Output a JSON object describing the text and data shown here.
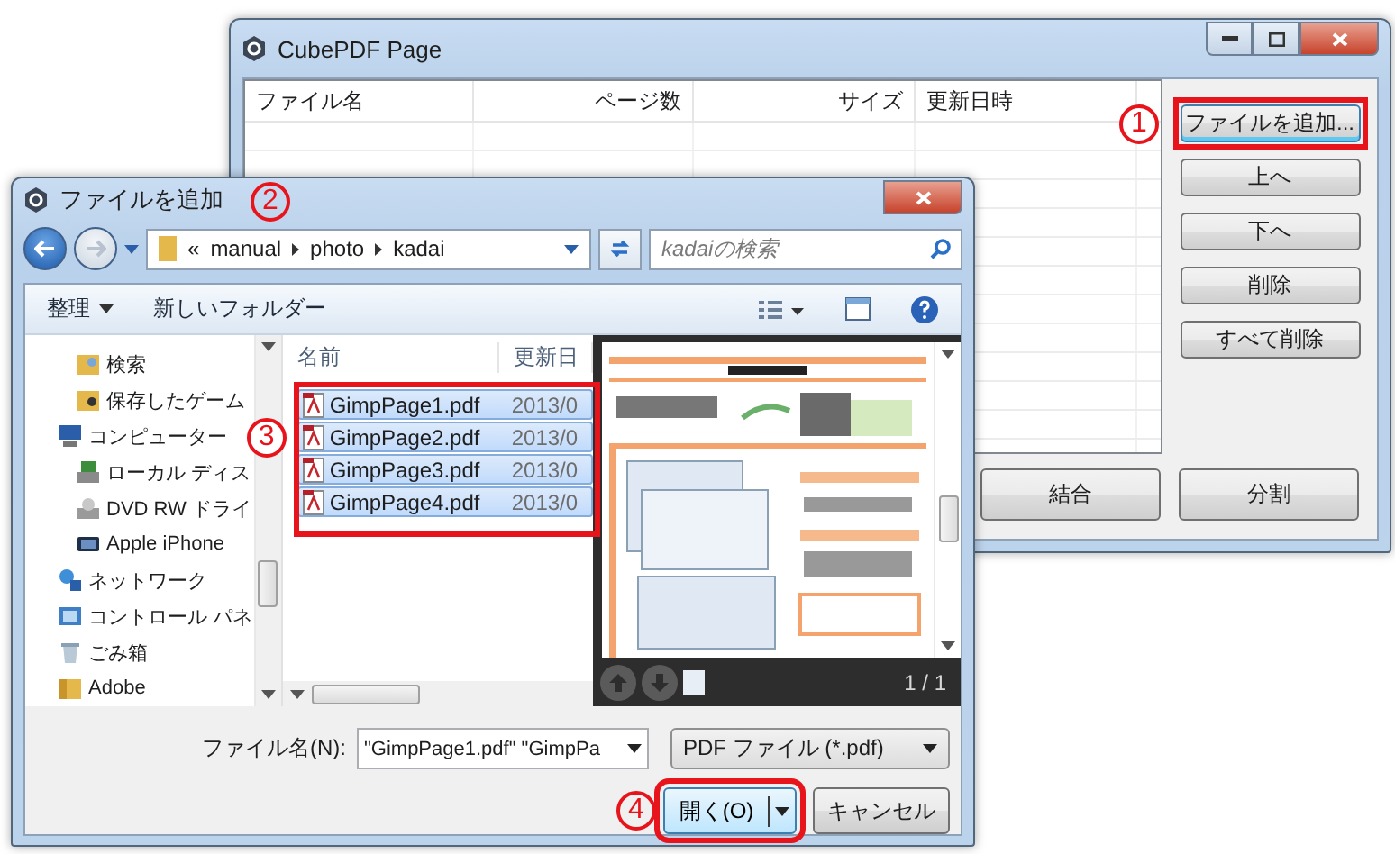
{
  "main_window": {
    "title": "CubePDF Page",
    "step": "1",
    "columns": [
      "ファイル名",
      "ページ数",
      "サイズ",
      "更新日時"
    ],
    "side_buttons": [
      {
        "label": "ファイルを追加...",
        "highlighted": true
      },
      {
        "label": "上へ",
        "highlighted": false
      },
      {
        "label": "下へ",
        "highlighted": false
      },
      {
        "label": "削除",
        "highlighted": false
      },
      {
        "label": "すべて削除",
        "highlighted": false
      }
    ],
    "bottom_buttons": [
      "結合",
      "分割"
    ]
  },
  "dialog": {
    "title": "ファイルを追加",
    "step": "2",
    "path_prefix": "«",
    "path": [
      "manual",
      "photo",
      "kadai"
    ],
    "search": {
      "placeholder": "kadaiの検索"
    },
    "organize": "整理",
    "new_folder": "新しいフォルダー",
    "nav_items": [
      {
        "label": "検索",
        "kind": "search-folder",
        "nested": true
      },
      {
        "label": "保存したゲーム",
        "kind": "games-folder",
        "nested": true
      },
      {
        "label": "コンピューター",
        "kind": "computer",
        "nested": false
      },
      {
        "label": "ローカル ディス",
        "kind": "disk",
        "nested": true
      },
      {
        "label": "DVD RW ドライ",
        "kind": "dvd",
        "nested": true
      },
      {
        "label": "Apple iPhone",
        "kind": "phone",
        "nested": true
      },
      {
        "label": "ネットワーク",
        "kind": "network",
        "nested": false
      },
      {
        "label": "コントロール パネ",
        "kind": "control-panel",
        "nested": false
      },
      {
        "label": "ごみ箱",
        "kind": "trash",
        "nested": false
      },
      {
        "label": "Adobe",
        "kind": "folder",
        "nested": false
      }
    ],
    "file_columns": [
      "名前",
      "更新日"
    ],
    "files_step": "3",
    "files": [
      {
        "name": "GimpPage1.pdf",
        "date": "2013/0",
        "selected": true
      },
      {
        "name": "GimpPage2.pdf",
        "date": "2013/0",
        "selected": true
      },
      {
        "name": "GimpPage3.pdf",
        "date": "2013/0",
        "selected": true
      },
      {
        "name": "GimpPage4.pdf",
        "date": "2013/0",
        "selected": true
      }
    ],
    "page_counter": "1 / 1",
    "filename_label": "ファイル名(N):",
    "filename_value": "\"GimpPage1.pdf\" \"GimpPa",
    "filter": "PDF ファイル (*.pdf)",
    "open_step": "4",
    "open_button": "開く(O)",
    "cancel_button": "キャンセル"
  }
}
